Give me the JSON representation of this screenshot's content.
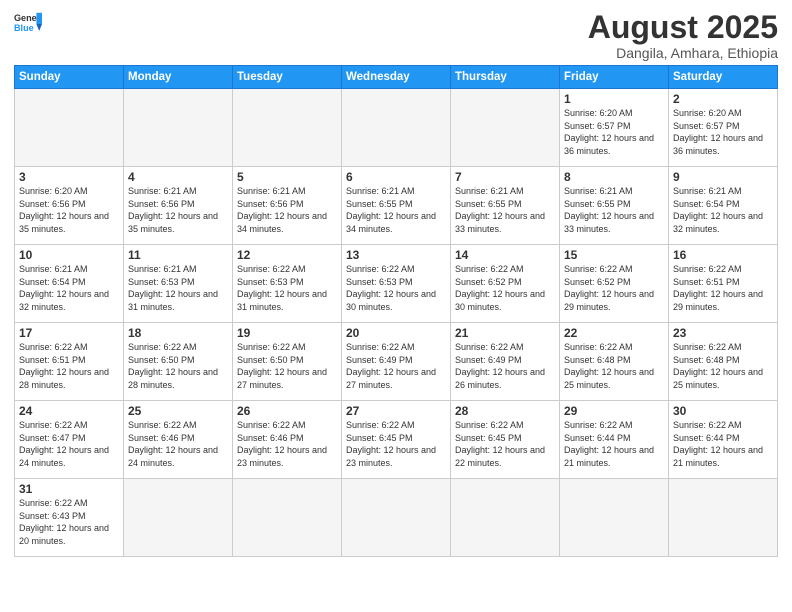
{
  "logo": {
    "general": "General",
    "blue": "Blue"
  },
  "title": "August 2025",
  "location": "Dangila, Amhara, Ethiopia",
  "weekdays": [
    "Sunday",
    "Monday",
    "Tuesday",
    "Wednesday",
    "Thursday",
    "Friday",
    "Saturday"
  ],
  "weeks": [
    [
      {
        "day": "",
        "info": ""
      },
      {
        "day": "",
        "info": ""
      },
      {
        "day": "",
        "info": ""
      },
      {
        "day": "",
        "info": ""
      },
      {
        "day": "",
        "info": ""
      },
      {
        "day": "1",
        "info": "Sunrise: 6:20 AM\nSunset: 6:57 PM\nDaylight: 12 hours\nand 36 minutes."
      },
      {
        "day": "2",
        "info": "Sunrise: 6:20 AM\nSunset: 6:57 PM\nDaylight: 12 hours\nand 36 minutes."
      }
    ],
    [
      {
        "day": "3",
        "info": "Sunrise: 6:20 AM\nSunset: 6:56 PM\nDaylight: 12 hours\nand 35 minutes."
      },
      {
        "day": "4",
        "info": "Sunrise: 6:21 AM\nSunset: 6:56 PM\nDaylight: 12 hours\nand 35 minutes."
      },
      {
        "day": "5",
        "info": "Sunrise: 6:21 AM\nSunset: 6:56 PM\nDaylight: 12 hours\nand 34 minutes."
      },
      {
        "day": "6",
        "info": "Sunrise: 6:21 AM\nSunset: 6:55 PM\nDaylight: 12 hours\nand 34 minutes."
      },
      {
        "day": "7",
        "info": "Sunrise: 6:21 AM\nSunset: 6:55 PM\nDaylight: 12 hours\nand 33 minutes."
      },
      {
        "day": "8",
        "info": "Sunrise: 6:21 AM\nSunset: 6:55 PM\nDaylight: 12 hours\nand 33 minutes."
      },
      {
        "day": "9",
        "info": "Sunrise: 6:21 AM\nSunset: 6:54 PM\nDaylight: 12 hours\nand 32 minutes."
      }
    ],
    [
      {
        "day": "10",
        "info": "Sunrise: 6:21 AM\nSunset: 6:54 PM\nDaylight: 12 hours\nand 32 minutes."
      },
      {
        "day": "11",
        "info": "Sunrise: 6:21 AM\nSunset: 6:53 PM\nDaylight: 12 hours\nand 31 minutes."
      },
      {
        "day": "12",
        "info": "Sunrise: 6:22 AM\nSunset: 6:53 PM\nDaylight: 12 hours\nand 31 minutes."
      },
      {
        "day": "13",
        "info": "Sunrise: 6:22 AM\nSunset: 6:53 PM\nDaylight: 12 hours\nand 30 minutes."
      },
      {
        "day": "14",
        "info": "Sunrise: 6:22 AM\nSunset: 6:52 PM\nDaylight: 12 hours\nand 30 minutes."
      },
      {
        "day": "15",
        "info": "Sunrise: 6:22 AM\nSunset: 6:52 PM\nDaylight: 12 hours\nand 29 minutes."
      },
      {
        "day": "16",
        "info": "Sunrise: 6:22 AM\nSunset: 6:51 PM\nDaylight: 12 hours\nand 29 minutes."
      }
    ],
    [
      {
        "day": "17",
        "info": "Sunrise: 6:22 AM\nSunset: 6:51 PM\nDaylight: 12 hours\nand 28 minutes."
      },
      {
        "day": "18",
        "info": "Sunrise: 6:22 AM\nSunset: 6:50 PM\nDaylight: 12 hours\nand 28 minutes."
      },
      {
        "day": "19",
        "info": "Sunrise: 6:22 AM\nSunset: 6:50 PM\nDaylight: 12 hours\nand 27 minutes."
      },
      {
        "day": "20",
        "info": "Sunrise: 6:22 AM\nSunset: 6:49 PM\nDaylight: 12 hours\nand 27 minutes."
      },
      {
        "day": "21",
        "info": "Sunrise: 6:22 AM\nSunset: 6:49 PM\nDaylight: 12 hours\nand 26 minutes."
      },
      {
        "day": "22",
        "info": "Sunrise: 6:22 AM\nSunset: 6:48 PM\nDaylight: 12 hours\nand 25 minutes."
      },
      {
        "day": "23",
        "info": "Sunrise: 6:22 AM\nSunset: 6:48 PM\nDaylight: 12 hours\nand 25 minutes."
      }
    ],
    [
      {
        "day": "24",
        "info": "Sunrise: 6:22 AM\nSunset: 6:47 PM\nDaylight: 12 hours\nand 24 minutes."
      },
      {
        "day": "25",
        "info": "Sunrise: 6:22 AM\nSunset: 6:46 PM\nDaylight: 12 hours\nand 24 minutes."
      },
      {
        "day": "26",
        "info": "Sunrise: 6:22 AM\nSunset: 6:46 PM\nDaylight: 12 hours\nand 23 minutes."
      },
      {
        "day": "27",
        "info": "Sunrise: 6:22 AM\nSunset: 6:45 PM\nDaylight: 12 hours\nand 23 minutes."
      },
      {
        "day": "28",
        "info": "Sunrise: 6:22 AM\nSunset: 6:45 PM\nDaylight: 12 hours\nand 22 minutes."
      },
      {
        "day": "29",
        "info": "Sunrise: 6:22 AM\nSunset: 6:44 PM\nDaylight: 12 hours\nand 21 minutes."
      },
      {
        "day": "30",
        "info": "Sunrise: 6:22 AM\nSunset: 6:44 PM\nDaylight: 12 hours\nand 21 minutes."
      }
    ],
    [
      {
        "day": "31",
        "info": "Sunrise: 6:22 AM\nSunset: 6:43 PM\nDaylight: 12 hours\nand 20 minutes."
      },
      {
        "day": "",
        "info": ""
      },
      {
        "day": "",
        "info": ""
      },
      {
        "day": "",
        "info": ""
      },
      {
        "day": "",
        "info": ""
      },
      {
        "day": "",
        "info": ""
      },
      {
        "day": "",
        "info": ""
      }
    ]
  ]
}
